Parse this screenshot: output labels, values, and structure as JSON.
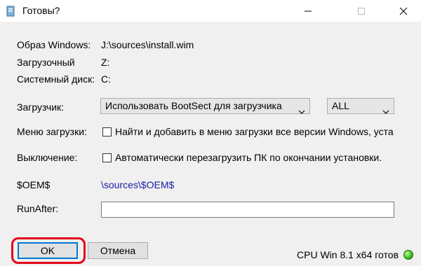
{
  "window": {
    "title": "Готовы?",
    "controls": {
      "minimize": "minimize-icon",
      "maximize": "maximize-icon",
      "close": "close-icon"
    }
  },
  "fields": {
    "image_label": "Образ Windows:",
    "image_value": "J:\\sources\\install.wim",
    "boot_label": "Загрузочный",
    "boot_value": "Z:",
    "system_label": "Системный диск:",
    "system_value": "C:"
  },
  "bootloader": {
    "label": "Загрузчик:",
    "selected": "Использовать BootSect для загрузчика",
    "target_selected": "ALL"
  },
  "boot_menu": {
    "label": "Меню загрузки:",
    "checkbox_text": "Найти и добавить в меню загрузки все версии Windows, уста",
    "checked": false
  },
  "shutdown": {
    "label": "Выключение:",
    "checkbox_text": "Автоматически перезагрузить ПК по окончании установки.",
    "checked": false
  },
  "oem": {
    "label": "$OEM$",
    "value": "\\sources\\$OEM$"
  },
  "runafter": {
    "label": "RunAfter:",
    "value": ""
  },
  "buttons": {
    "ok": "OK",
    "cancel": "Отмена"
  },
  "status": {
    "text": "CPU Win 8.1 x64 готов",
    "indicator_color": "#39c21a"
  },
  "colors": {
    "highlight": "#e2001a",
    "link": "#1a1aa6",
    "focus": "#0078d7"
  }
}
